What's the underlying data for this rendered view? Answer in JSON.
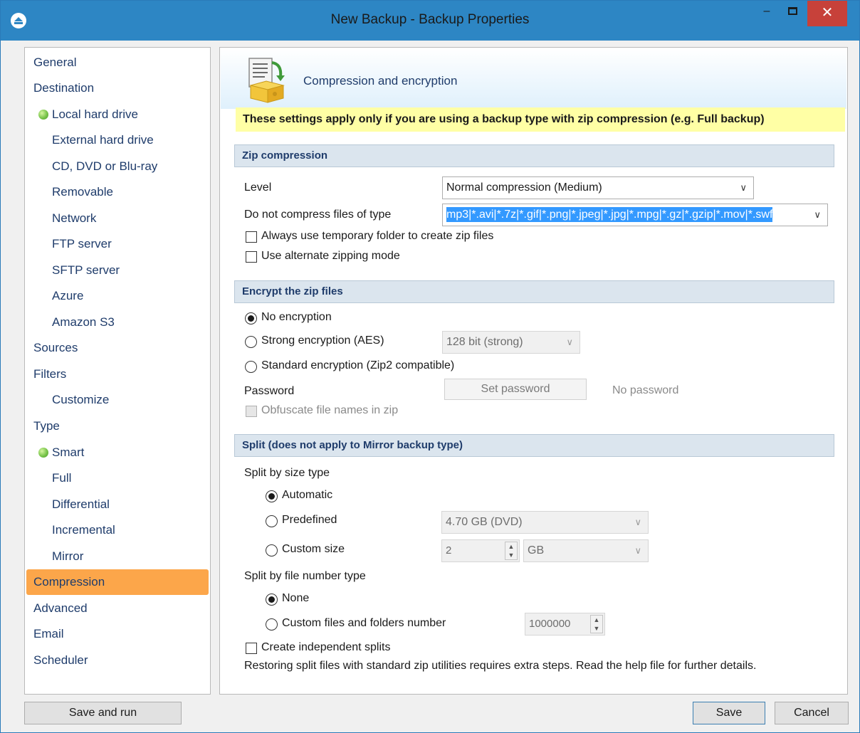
{
  "window": {
    "title": "New Backup - Backup Properties",
    "min_label": "–",
    "close_label": "✕"
  },
  "sidebar": {
    "items": [
      {
        "label": "General",
        "level": 0
      },
      {
        "label": "Destination",
        "level": 0
      },
      {
        "label": "Local hard drive",
        "level": 1,
        "active_dot": true
      },
      {
        "label": "External hard drive",
        "level": 1
      },
      {
        "label": "CD, DVD or Blu-ray",
        "level": 1
      },
      {
        "label": "Removable",
        "level": 1
      },
      {
        "label": "Network",
        "level": 1
      },
      {
        "label": "FTP server",
        "level": 1
      },
      {
        "label": "SFTP server",
        "level": 1
      },
      {
        "label": "Azure",
        "level": 1
      },
      {
        "label": "Amazon S3",
        "level": 1
      },
      {
        "label": "Sources",
        "level": 0
      },
      {
        "label": "Filters",
        "level": 0
      },
      {
        "label": "Customize",
        "level": 1
      },
      {
        "label": "Type",
        "level": 0
      },
      {
        "label": "Smart",
        "level": 1,
        "active_dot": true
      },
      {
        "label": "Full",
        "level": 1
      },
      {
        "label": "Differential",
        "level": 1
      },
      {
        "label": "Incremental",
        "level": 1
      },
      {
        "label": "Mirror",
        "level": 1
      },
      {
        "label": "Compression",
        "level": 0,
        "selected": true
      },
      {
        "label": "Advanced",
        "level": 0
      },
      {
        "label": "Email",
        "level": 0
      },
      {
        "label": "Scheduler",
        "level": 0
      }
    ]
  },
  "header": {
    "title": "Compression and encryption",
    "notice": "These settings apply only if you are using a backup type with zip compression (e.g. Full backup)"
  },
  "zip": {
    "section_title": "Zip compression",
    "level_label": "Level",
    "level_value": "Normal compression (Medium)",
    "no_compress_label": "Do not compress files of type",
    "no_compress_value": "mp3|*.avi|*.7z|*.gif|*.png|*.jpeg|*.jpg|*.mpg|*.gz|*.gzip|*.mov|*.swf",
    "temp_folder_label": "Always use temporary folder to create zip files",
    "temp_folder_checked": false,
    "alt_mode_label": "Use alternate zipping mode",
    "alt_mode_checked": false
  },
  "encrypt": {
    "section_title": "Encrypt the zip files",
    "none_label": "No encryption",
    "aes_label": "Strong encryption (AES)",
    "aes_strength": "128 bit (strong)",
    "zip2_label": "Standard encryption (Zip2 compatible)",
    "selected": "none",
    "password_label": "Password",
    "set_password_label": "Set password",
    "password_status": "No password",
    "obfuscate_label": "Obfuscate file names in zip",
    "obfuscate_checked": false
  },
  "split": {
    "section_title": "Split (does not apply to Mirror backup type)",
    "size_type_label": "Split by size type",
    "automatic_label": "Automatic",
    "predefined_label": "Predefined",
    "predefined_value": "4.70 GB (DVD)",
    "custom_size_label": "Custom size",
    "custom_size_value": "2",
    "custom_size_unit": "GB",
    "size_selected": "automatic",
    "file_number_label": "Split by file number type",
    "none_label": "None",
    "custom_files_label": "Custom files and folders number",
    "custom_files_value": "1000000",
    "file_number_selected": "none",
    "independent_label": "Create independent splits",
    "independent_checked": false,
    "note": "Restoring split files with standard zip utilities requires extra steps. Read the help file for further details."
  },
  "footer": {
    "save_run_label": "Save and run",
    "save_label": "Save",
    "cancel_label": "Cancel"
  },
  "colors": {
    "titlebar": "#2d86c4",
    "close_button": "#c7413a",
    "selected_nav": "#fca64a",
    "notice_bg": "#ffffa5",
    "section_bg": "#dbe5ee",
    "selection_highlight": "#3399ff",
    "status_dot": "#78c44a"
  },
  "icons": {
    "app": "backup-app-icon",
    "header": "compression-box-icon",
    "dropdown": "chevron-down-icon",
    "spinner": "spinner-arrows-icon"
  }
}
